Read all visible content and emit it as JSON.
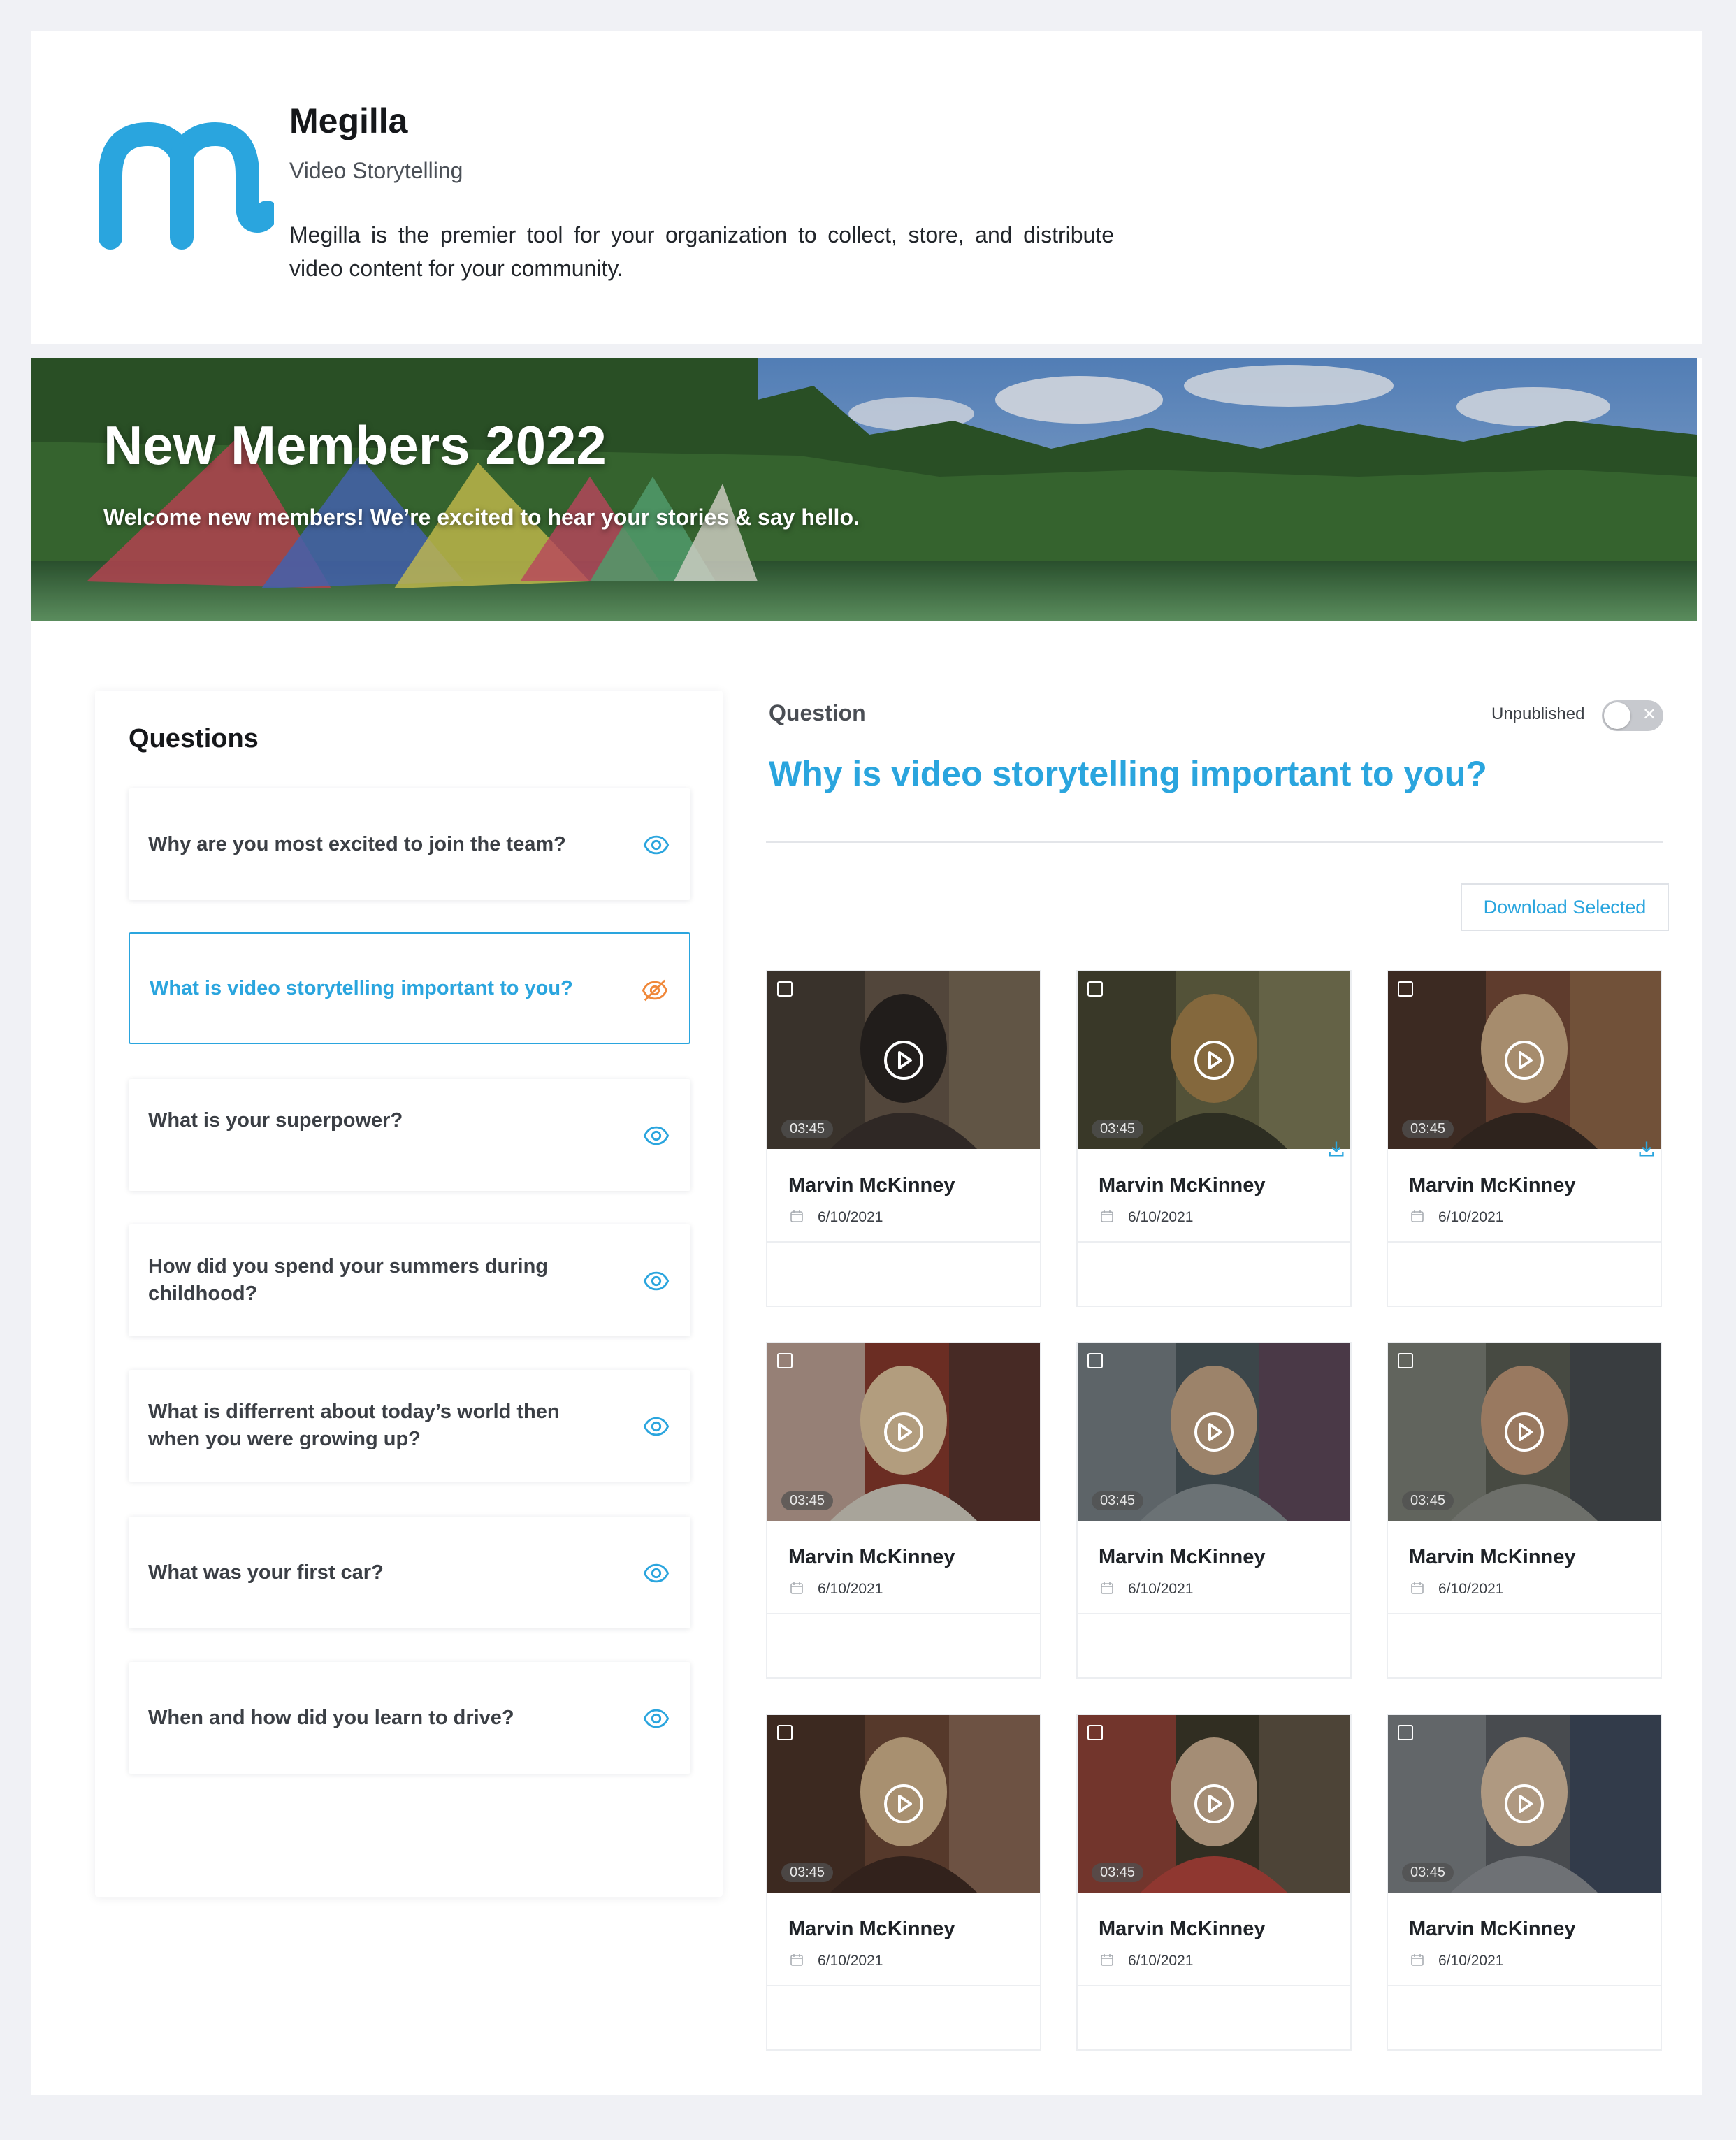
{
  "header": {
    "org_name": "Megilla",
    "org_subtitle": "Video Storytelling",
    "org_description": "Megilla is the premier tool for your organization to collect, store, and distribute video content for your community."
  },
  "banner": {
    "title": "New Members 2022",
    "subtitle": "Welcome new members! We’re excited to hear your stories & say hello."
  },
  "questions_panel": {
    "title": "Questions",
    "items": [
      {
        "text": "Why are you most excited to join the team?",
        "icon": "eye-icon",
        "active": false
      },
      {
        "text": "What is video storytelling important to you?",
        "icon": "eye-off-icon",
        "active": true
      },
      {
        "text": "What is your superpower?",
        "icon": "eye-icon",
        "active": false
      },
      {
        "text": "How did you spend your summers during childhood?",
        "icon": "eye-icon",
        "active": false
      },
      {
        "text": "What is differrent about today’s world then when you were growing up?",
        "icon": "eye-icon",
        "active": false
      },
      {
        "text": "What was your first car?",
        "icon": "eye-icon",
        "active": false
      },
      {
        "text": "When and how did you learn to drive?",
        "icon": "eye-icon",
        "active": false
      }
    ]
  },
  "question_detail": {
    "label": "Question",
    "status_label": "Unpublished",
    "published": false,
    "title": "Why is video storytelling important to you?",
    "download_label": "Download Selected"
  },
  "videos": [
    {
      "name": "Marvin McKinney",
      "date": "6/10/2021",
      "duration": "03:45",
      "download_icon": false
    },
    {
      "name": "Marvin McKinney",
      "date": "6/10/2021",
      "duration": "03:45",
      "download_icon": true
    },
    {
      "name": "Marvin McKinney",
      "date": "6/10/2021",
      "duration": "03:45",
      "download_icon": true
    },
    {
      "name": "Marvin McKinney",
      "date": "6/10/2021",
      "duration": "03:45",
      "download_icon": false
    },
    {
      "name": "Marvin McKinney",
      "date": "6/10/2021",
      "duration": "03:45",
      "download_icon": false
    },
    {
      "name": "Marvin McKinney",
      "date": "6/10/2021",
      "duration": "03:45",
      "download_icon": false
    },
    {
      "name": "Marvin McKinney",
      "date": "6/10/2021",
      "duration": "03:45",
      "download_icon": false
    },
    {
      "name": "Marvin McKinney",
      "date": "6/10/2021",
      "duration": "03:45",
      "download_icon": false
    },
    {
      "name": "Marvin McKinney",
      "date": "6/10/2021",
      "duration": "03:45",
      "download_icon": false
    }
  ],
  "colors": {
    "accent": "#2aa5de",
    "hidden_icon": "#f0883a",
    "background": "#f0f1f5"
  }
}
